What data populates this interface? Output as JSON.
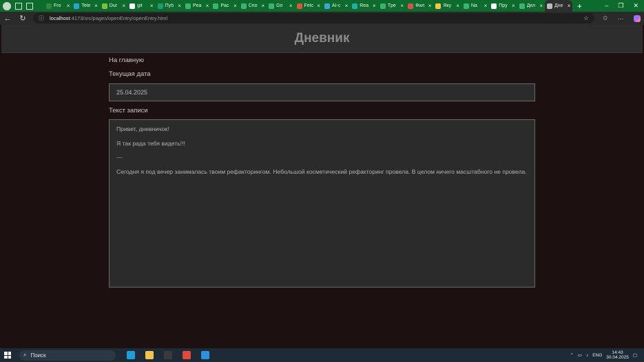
{
  "browser": {
    "tabs": [
      {
        "label": "Fro",
        "color": "#2d8a3b"
      },
      {
        "label": "Tele",
        "color": "#29a3dd"
      },
      {
        "label": "Dur",
        "color": "#7ac142"
      },
      {
        "label": "git",
        "color": "#ffffff"
      },
      {
        "label": "Пуб",
        "color": "#1a9e6d"
      },
      {
        "label": "Pea",
        "color": "#3cb371"
      },
      {
        "label": "Pac",
        "color": "#3cb371"
      },
      {
        "label": "Спо",
        "color": "#3cb371"
      },
      {
        "label": "Gri",
        "color": "#3cb371"
      },
      {
        "label": "Fetc",
        "color": "#e0533a"
      },
      {
        "label": "AI-c",
        "color": "#3ea4d9"
      },
      {
        "label": "Rea",
        "color": "#1fb0a0"
      },
      {
        "label": "Tpe",
        "color": "#3cb371"
      },
      {
        "label": "Фил",
        "color": "#d9534f"
      },
      {
        "label": "Яку",
        "color": "#f2c744"
      },
      {
        "label": "Na",
        "color": "#3cb371"
      },
      {
        "label": "Пру",
        "color": "#ffffff"
      },
      {
        "label": "Дел",
        "color": "#3cb371"
      },
      {
        "label": "Дне",
        "color": "#bbbbbb"
      }
    ],
    "tab_close": "×",
    "new_tab": "+",
    "url_host": "localhost",
    "url_path": ":4173/src/pages/openEntry/openEntry.html"
  },
  "page": {
    "title": "Дневник",
    "home_link": "На главную",
    "date_label": "Текущая дата",
    "date_value": "25.04.2025",
    "text_label": "Текст записи",
    "entry_paragraphs": [
      "Привет, дневничок!",
      "Я так рада тебя видеть!!!",
      "---",
      "Сегодня я под вечер занималась твоим рефакторингом. Небольшой косметический рефакторинг провела. В целом ничего масштабного не провела."
    ]
  },
  "taskbar": {
    "search_placeholder": "Поиск",
    "apps": [
      {
        "icon": "edge-icon",
        "color": "#1ba0d8"
      },
      {
        "icon": "folder-icon",
        "color": "#f2c24a"
      },
      {
        "icon": "terminal-icon",
        "color": "#3a3a3a"
      },
      {
        "icon": "app-icon",
        "color": "#e04a3a"
      },
      {
        "icon": "vscode-icon",
        "color": "#2f8fe0"
      }
    ],
    "lang": "ENG",
    "time": "14:43",
    "date": "30.04.2025"
  }
}
